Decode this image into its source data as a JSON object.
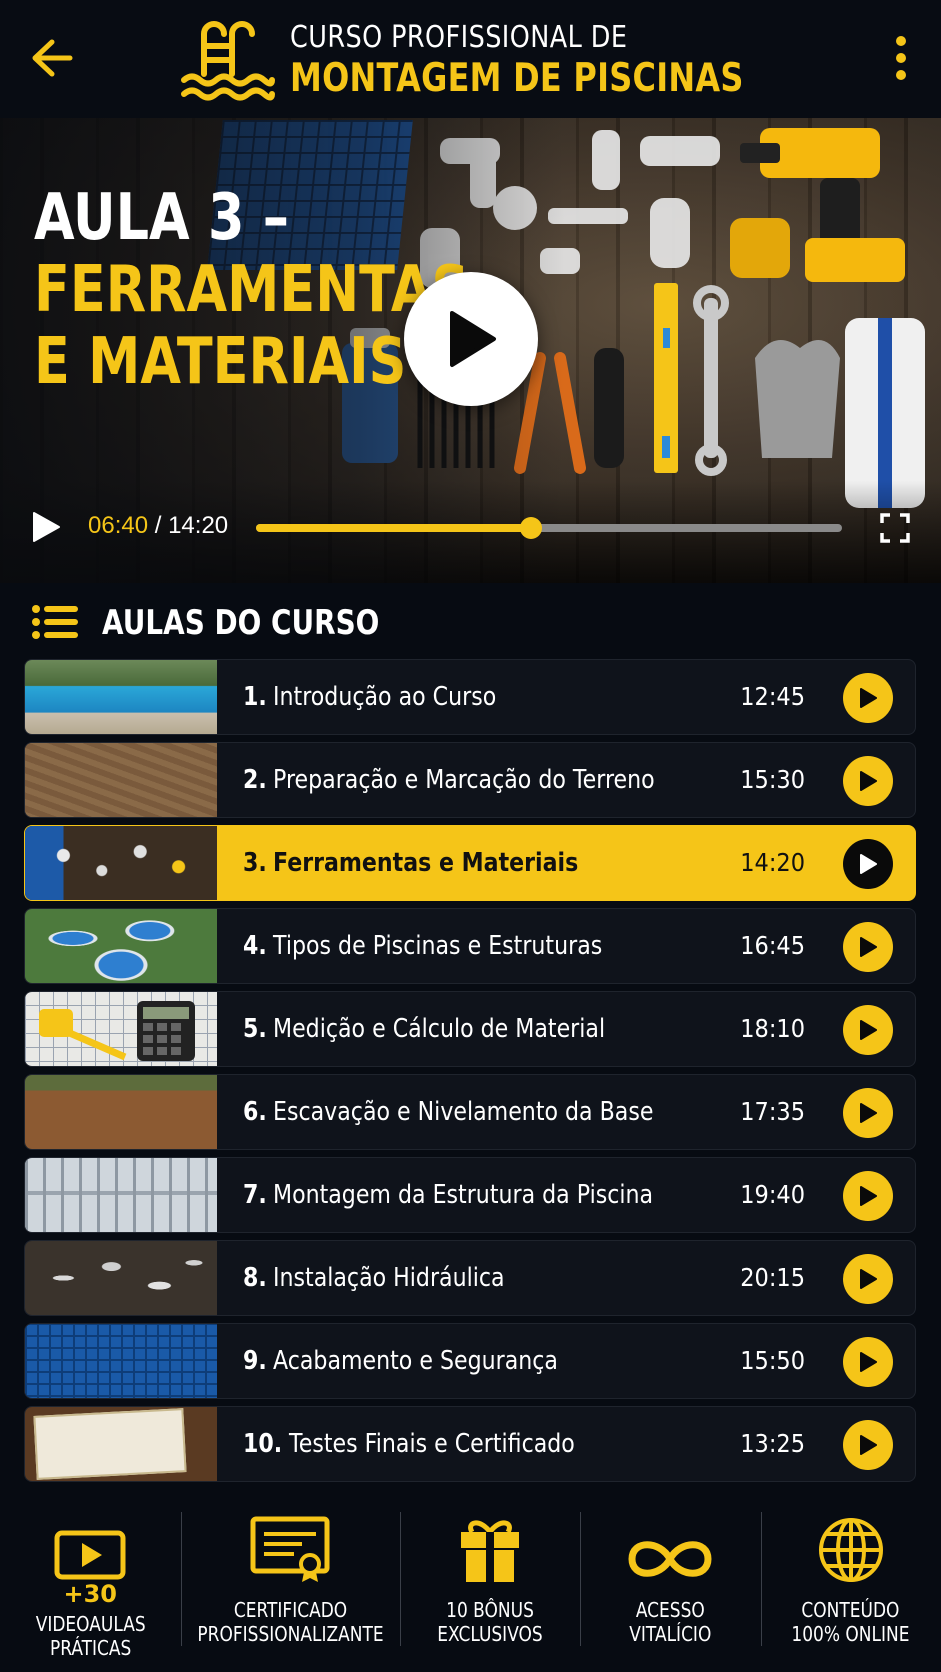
{
  "header": {
    "title_line1": "CURSO PROFISSIONAL DE",
    "title_line2": "MONTAGEM DE PISCINAS",
    "logo_icon": "pool-ladder-icon",
    "back_icon": "arrow-left-icon",
    "menu_icon": "kebab-menu-icon"
  },
  "video": {
    "title_line1": "AULA 3 –",
    "title_line2": "FERRAMENTAS",
    "title_line3": "E MATERIAIS",
    "current_time": "06:40",
    "separator": " / ",
    "total_time": "14:20",
    "progress_fraction": 0.47
  },
  "lessons_section": {
    "title": "AULAS DO CURSO",
    "icon": "list-icon"
  },
  "lessons": [
    {
      "number": "1.",
      "title": "Introdução ao Curso",
      "duration": "12:45",
      "thumb": "th-pool"
    },
    {
      "number": "2.",
      "title": "Preparação e Marcação do Terreno",
      "duration": "15:30",
      "thumb": "th-dirt"
    },
    {
      "number": "3.",
      "title": "Ferramentas e Materiais",
      "duration": "14:20",
      "thumb": "th-tools",
      "active": true
    },
    {
      "number": "4.",
      "title": "Tipos de Piscinas e Estruturas",
      "duration": "16:45",
      "thumb": "th-pools"
    },
    {
      "number": "5.",
      "title": "Medição e Cálculo de Material",
      "duration": "18:10",
      "thumb": "th-plan"
    },
    {
      "number": "6.",
      "title": "Escavação e Nivelamento da Base",
      "duration": "17:35",
      "thumb": "th-dig"
    },
    {
      "number": "7.",
      "title": "Montagem da Estrutura da Piscina",
      "duration": "19:40",
      "thumb": "th-frame"
    },
    {
      "number": "8.",
      "title": "Instalação Hidráulica",
      "duration": "20:15",
      "thumb": "th-pipes"
    },
    {
      "number": "9.",
      "title": "Acabamento e Segurança",
      "duration": "15:50",
      "thumb": "th-finish"
    },
    {
      "number": "10.",
      "title": "Testes Finais e Certificado",
      "duration": "13:25",
      "thumb": "th-cert"
    }
  ],
  "features": [
    {
      "icon": "video-play-icon",
      "badge": "+30",
      "line1": "VIDEOAULAS",
      "line2": "PRÁTICAS"
    },
    {
      "icon": "certificate-icon",
      "badge": "",
      "line1": "CERTIFICADO",
      "line2": "PROFISSIONALIZANTE"
    },
    {
      "icon": "gift-icon",
      "badge": "",
      "line1": "10 BÔNUS",
      "line2": "EXCLUSIVOS"
    },
    {
      "icon": "infinity-icon",
      "badge": "",
      "line1": "ACESSO",
      "line2": "VITALÍCIO"
    },
    {
      "icon": "globe-icon",
      "badge": "",
      "line1": "CONTEÚDO",
      "line2": "100% ONLINE"
    }
  ],
  "colors": {
    "accent": "#f5c518",
    "background": "#070b12",
    "row_background": "#0f131b"
  }
}
